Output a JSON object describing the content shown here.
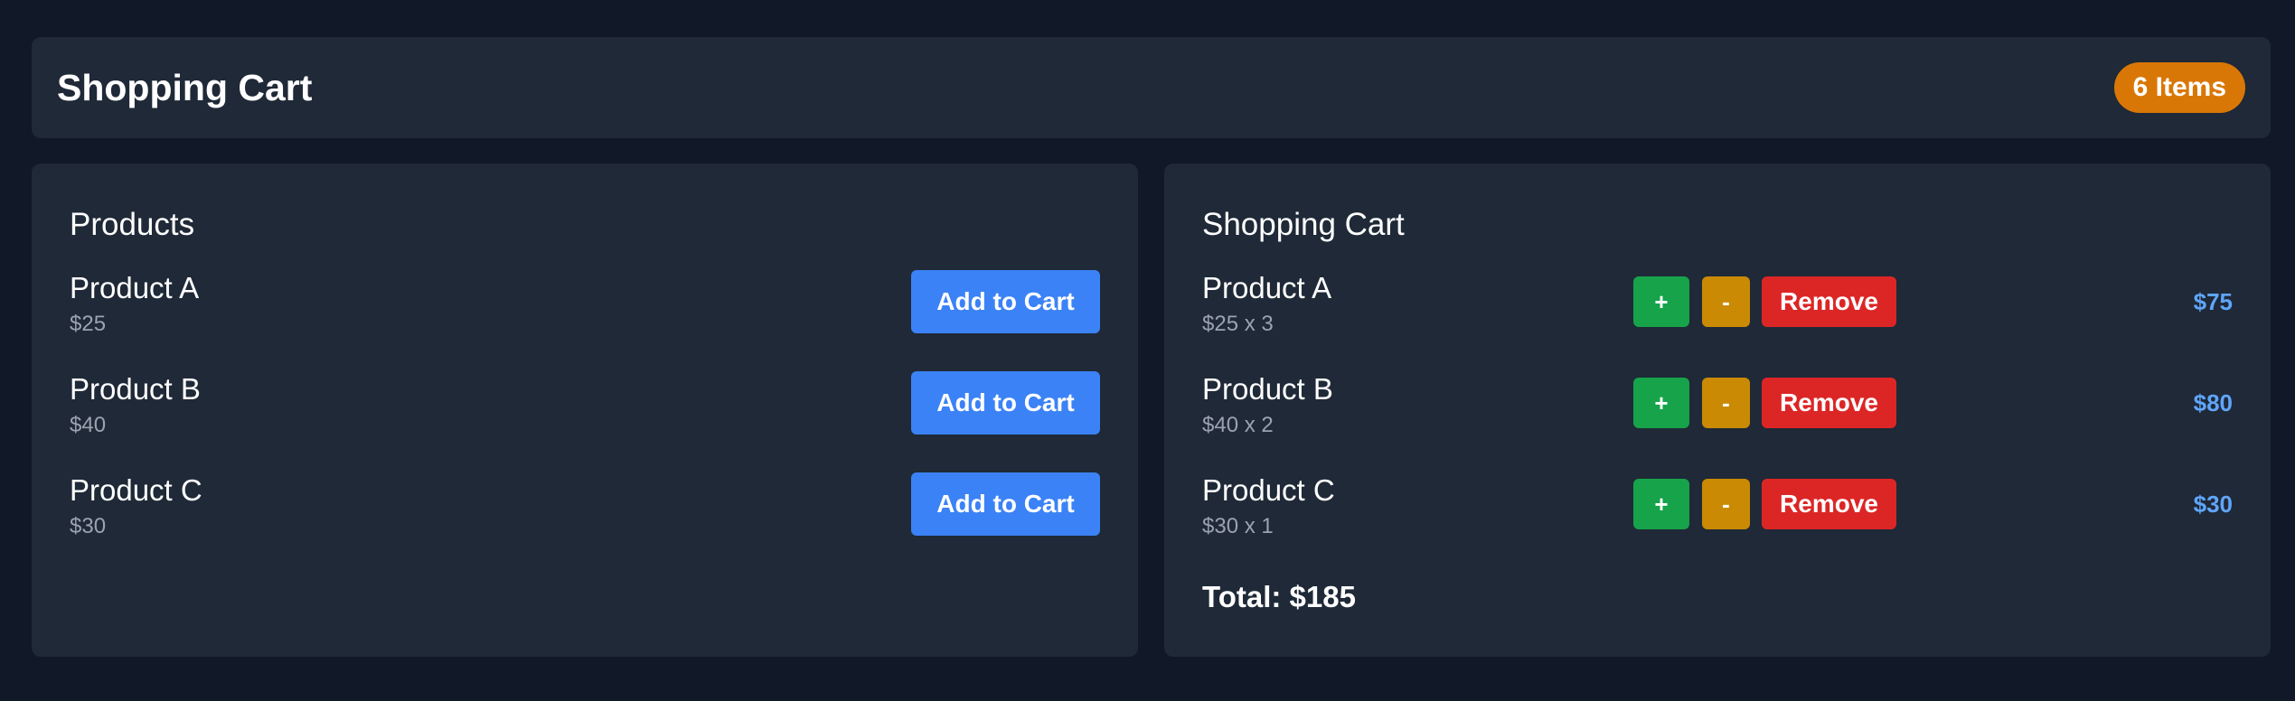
{
  "header": {
    "title": "Shopping Cart",
    "badge": "6 Items"
  },
  "products": {
    "title": "Products",
    "items": [
      {
        "name": "Product A",
        "price": "$25",
        "button": "Add to Cart"
      },
      {
        "name": "Product B",
        "price": "$40",
        "button": "Add to Cart"
      },
      {
        "name": "Product C",
        "price": "$30",
        "button": "Add to Cart"
      }
    ]
  },
  "cart": {
    "title": "Shopping Cart",
    "items": [
      {
        "name": "Product A",
        "detail": "$25 x 3",
        "plus": "+",
        "minus": "-",
        "remove": "Remove",
        "line_total": "$75"
      },
      {
        "name": "Product B",
        "detail": "$40 x 2",
        "plus": "+",
        "minus": "-",
        "remove": "Remove",
        "line_total": "$80"
      },
      {
        "name": "Product C",
        "detail": "$30 x 1",
        "plus": "+",
        "minus": "-",
        "remove": "Remove",
        "line_total": "$30"
      }
    ],
    "total": "Total: $185"
  },
  "colors": {
    "background": "#111827",
    "panel": "#1f2937",
    "badge": "#d97706",
    "add_button": "#3b82f6",
    "plus_button": "#16a34a",
    "minus_button": "#ca8a04",
    "remove_button": "#dc2626",
    "line_total": "#60a5fa"
  }
}
